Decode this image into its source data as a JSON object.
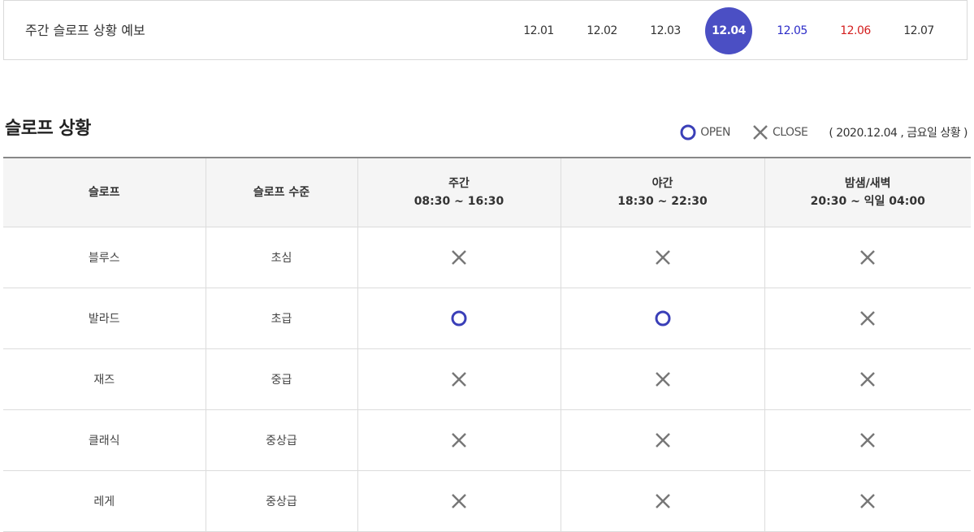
{
  "forecast": {
    "title": "주간 슬로프 상황 예보",
    "dates": [
      {
        "label": "12.01",
        "kind": "normal"
      },
      {
        "label": "12.02",
        "kind": "normal"
      },
      {
        "label": "12.03",
        "kind": "normal"
      },
      {
        "label": "12.04",
        "kind": "selected"
      },
      {
        "label": "12.05",
        "kind": "sat"
      },
      {
        "label": "12.06",
        "kind": "sun"
      },
      {
        "label": "12.07",
        "kind": "normal"
      }
    ]
  },
  "section": {
    "title": "슬로프 상황",
    "legend_open": "OPEN",
    "legend_close": "CLOSE",
    "date_note": "( 2020.12.04 , 금요일 상황 )"
  },
  "table": {
    "headers": [
      {
        "line1": "슬로프",
        "line2": ""
      },
      {
        "line1": "슬로프 수준",
        "line2": ""
      },
      {
        "line1": "주간",
        "line2": "08:30 ~ 16:30"
      },
      {
        "line1": "야간",
        "line2": "18:30 ~ 22:30"
      },
      {
        "line1": "밤샘/새벽",
        "line2": "20:30 ~ 익일 04:00"
      }
    ],
    "rows": [
      {
        "slope": "블루스",
        "level": "초심",
        "status": [
          "close",
          "close",
          "close"
        ]
      },
      {
        "slope": "발라드",
        "level": "초급",
        "status": [
          "open",
          "open",
          "close"
        ]
      },
      {
        "slope": "재즈",
        "level": "중급",
        "status": [
          "close",
          "close",
          "close"
        ]
      },
      {
        "slope": "클래식",
        "level": "중상급",
        "status": [
          "close",
          "close",
          "close"
        ]
      },
      {
        "slope": "레게",
        "level": "중상급",
        "status": [
          "close",
          "close",
          "close"
        ]
      }
    ]
  },
  "colors": {
    "accent": "#4b4fc4",
    "open_icon": "#3a3fb8",
    "close_icon": "#777777",
    "saturday": "#2c2cc8",
    "sunday": "#d42020"
  }
}
